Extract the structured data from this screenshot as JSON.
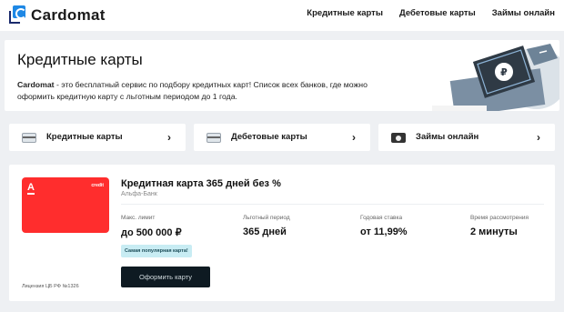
{
  "header": {
    "logo_text": "Cardomat",
    "nav": [
      "Кредитные карты",
      "Дебетовые карты",
      "Займы онлайн"
    ]
  },
  "hero": {
    "title": "Кредитные карты",
    "brand": "Cardomat",
    "description": " - это бесплатный сервис по подбору кредитных карт! Список всех банков, где можно оформить кредитную карту с льготным периодом до 1 года."
  },
  "categories": [
    {
      "label": "Кредитные карты",
      "icon": "credit-card-icon"
    },
    {
      "label": "Дебетовые карты",
      "icon": "debit-card-icon"
    },
    {
      "label": "Займы онлайн",
      "icon": "coin-icon"
    }
  ],
  "offer": {
    "title": "Кредитная карта 365 дней без %",
    "bank": "Альфа-Банк",
    "card_text": "credit",
    "license": "Лицензия ЦБ РФ №1326",
    "stats": [
      {
        "label": "Макс. лимит",
        "value": "до 500 000 ₽"
      },
      {
        "label": "Льготный период",
        "value": "365 дней"
      },
      {
        "label": "Годовая ставка",
        "value": "от 11,99%"
      },
      {
        "label": "Время рассмотрения",
        "value": "2 минуты"
      }
    ],
    "badge": "Самая популярная карта!",
    "button": "Оформить карту"
  },
  "colors": {
    "accent": "#1e88e5",
    "card_red": "#ff2d2d",
    "button_dark": "#0e1a22",
    "badge_bg": "#c8ecf3"
  }
}
